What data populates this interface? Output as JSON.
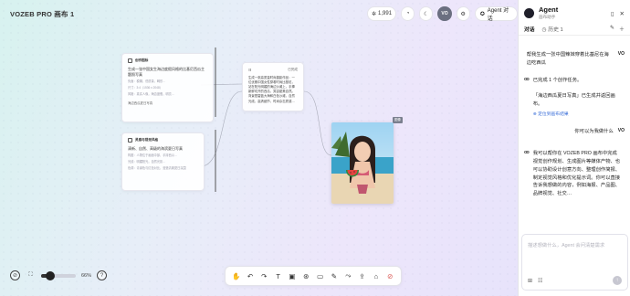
{
  "app": {
    "title": "VOZEB PRO 画布 1"
  },
  "topbar": {
    "credits": "1,991",
    "avatar": "VO",
    "agent_label": "Agent 对话"
  },
  "nodes": [
    {
      "header": "创作图标",
      "prompt": "生成一张中国女生海边度假风格的比基尼西瓜主题照写真",
      "meta1": "负面：模糊，低质量，畸形…",
      "meta2": "尺寸：3:4（1536 x 2048）",
      "meta3": "风格：真实人像，海边度假，明亮…",
      "footer": "海边西瓜夏日写真"
    },
    {
      "header": "",
      "label": "已完成",
      "body": "生成一张高质量时尚摄影作品：一位优雅中国女性穿着时尚比基尼，站在阳光明媚的海边沙滩上，手捧新鲜切开的西瓜，笑容甜美自然。背景是碧蓝大海和白色沙滩，自然光线，高清细节，时尚杂志质感…"
    },
    {
      "header": "灵感与视觉风格",
      "prompt": "清新、自然、高级的海滨夏日写真",
      "meta1": "构图：人物位于画面中部，手持西瓜…",
      "meta2": "光线：明媚阳光，自然光影…",
      "footer": "色调：青绿色与红色对比，营造清爽夏日氛围"
    }
  ],
  "photo_tag": "图像",
  "zoom": {
    "label": "66%",
    "fraction": 0.25
  },
  "toolbar": {
    "tools": [
      "hand-icon",
      "undo-icon",
      "redo-icon",
      "text-icon",
      "image-icon",
      "shapes-icon",
      "video-icon",
      "pen-icon",
      "arrow-icon",
      "upload-icon",
      "folder-icon",
      "delete-icon"
    ]
  },
  "panel": {
    "title": "Agent",
    "subtitle": "画布助手",
    "tab_active": "对话",
    "tab_history": "历史 1",
    "messages": [
      {
        "role": "user",
        "text": "帮我生成一张中国辣妹穿着比基尼在海边吃西瓜",
        "avatar": "VO"
      },
      {
        "role": "bot",
        "lines": [
          "已完成 1 个创作任务。",
          "「海边西瓜夏日写真」已生成并返回画布。"
        ],
        "link": "定位到画布结果"
      },
      {
        "role": "user",
        "text": "你可以为我做什么",
        "avatar": "VO"
      },
      {
        "role": "bot",
        "lines": [
          "我可以帮你在 VOZEB PRO 画布中完成视觉创作规划、生成图片等媒体产物、也可以协助设计创意方向、整理创作简报、制定视觉风格和优化提示词。你可以直接告诉我想做的内容，例如海报、产品图、品牌视觉、社交…"
        ]
      }
    ],
    "input_placeholder": "描述想做什么，Agent 会问清楚需求",
    "colors": {
      "accent": "#3b6fd9",
      "avatar": "#6b6f80"
    }
  }
}
